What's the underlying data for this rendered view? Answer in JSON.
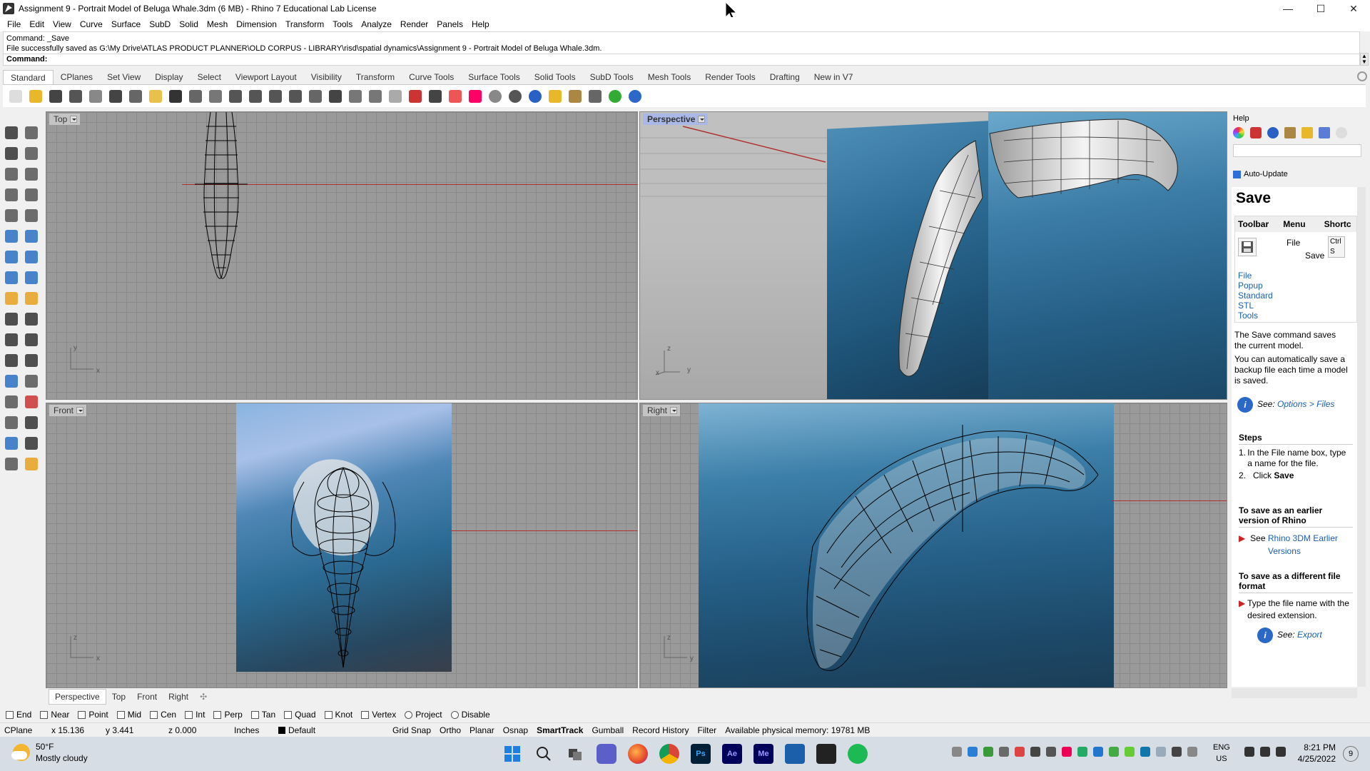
{
  "window": {
    "title": "Assignment 9 - Portrait Model of Beluga Whale.3dm (6 MB) - Rhino 7 Educational Lab License",
    "controls": {
      "minimize": "—",
      "maximize": "☐",
      "close": "✕"
    }
  },
  "menu": [
    "File",
    "Edit",
    "View",
    "Curve",
    "Surface",
    "SubD",
    "Solid",
    "Mesh",
    "Dimension",
    "Transform",
    "Tools",
    "Analyze",
    "Render",
    "Panels",
    "Help"
  ],
  "command": {
    "history_1": "Command: _Save",
    "history_2": "File successfully saved as G:\\My Drive\\ATLAS PRODUCT PLANNER\\OLD CORPUS - LIBRARY\\risd\\spatial dynamics\\Assignment 9 - Portrait Model of Beluga Whale.3dm.",
    "prompt": "Command:",
    "value": ""
  },
  "toolbar_tabs": [
    "Standard",
    "CPlanes",
    "Set View",
    "Display",
    "Select",
    "Viewport Layout",
    "Visibility",
    "Transform",
    "Curve Tools",
    "Surface Tools",
    "Solid Tools",
    "SubD Tools",
    "Mesh Tools",
    "Render Tools",
    "Drafting",
    "New in V7"
  ],
  "toolbar_icons": [
    "new-icon",
    "open-icon",
    "save-icon",
    "print-icon",
    "import-icon",
    "cut-icon",
    "copy-icon",
    "paste-icon",
    "undo-icon",
    "pan-hand-icon",
    "move-view-icon",
    "zoom-icon",
    "zoom-window-icon",
    "zoom-extents-icon",
    "zoom-selected-icon",
    "rotate-view-icon",
    "four-views-icon",
    "cplane-icon",
    "set-view-icon",
    "ghost-icon",
    "hide-icon",
    "lock-icon",
    "layer-icon",
    "color-icon",
    "shaded-icon",
    "rendered-icon",
    "material-icon",
    "select-filter-icon",
    "settings-icon",
    "lights-icon",
    "render-icon",
    "help-icon"
  ],
  "viewports": {
    "top": {
      "label": "Top",
      "axis_y": "y",
      "axis_x": "x"
    },
    "perspective": {
      "label": "Perspective",
      "axis_z": "z",
      "axis_x": "x",
      "axis_y": "y"
    },
    "front": {
      "label": "Front",
      "axis_z": "z",
      "axis_x": "x"
    },
    "right": {
      "label": "Right",
      "axis_z": "z",
      "axis_y": "y"
    }
  },
  "viewport_tabs": [
    "Perspective",
    "Top",
    "Front",
    "Right"
  ],
  "osnaps": [
    {
      "label": "End",
      "checked": false
    },
    {
      "label": "Near",
      "checked": false
    },
    {
      "label": "Point",
      "checked": false
    },
    {
      "label": "Mid",
      "checked": false
    },
    {
      "label": "Cen",
      "checked": false
    },
    {
      "label": "Int",
      "checked": false
    },
    {
      "label": "Perp",
      "checked": false
    },
    {
      "label": "Tan",
      "checked": false
    },
    {
      "label": "Quad",
      "checked": false
    },
    {
      "label": "Knot",
      "checked": false
    },
    {
      "label": "Vertex",
      "checked": false
    },
    {
      "label": "Project",
      "checked": false
    },
    {
      "label": "Disable",
      "checked": false
    }
  ],
  "status": {
    "cplane": "CPlane",
    "x": "x 15.136",
    "y": "y 3.441",
    "z": "z 0.000",
    "units": "Inches",
    "layer": "Default",
    "grid_snap": "Grid Snap",
    "ortho": "Ortho",
    "planar": "Planar",
    "osnap": "Osnap",
    "smarttrack": "SmartTrack",
    "gumball": "Gumball",
    "record_history": "Record History",
    "filter": "Filter",
    "memory": "Available physical memory: 19781 MB"
  },
  "help": {
    "panel_title": "Help",
    "auto_update": "Auto-Update",
    "heading": "Save",
    "table_headers": [
      "Toolbar",
      "Menu",
      "Shortc"
    ],
    "toolbar_links": [
      "File",
      "Popup",
      "Standard",
      "STL",
      "Tools"
    ],
    "menu_path": [
      "File",
      "Save"
    ],
    "shortcut": [
      "Ctrl",
      "S"
    ],
    "desc_1": "The Save command saves the current model.",
    "desc_2": "You can automatically save a backup file each time a model is saved.",
    "see_label": "See:",
    "see_link": "Options > Files",
    "steps_title": "Steps",
    "step_1a": "In the File name box, type a name for the file.",
    "step_2_prefix": "Click",
    "step_2_bold": "Save",
    "earlier_title": "To save as an earlier version of Rhino",
    "earlier_prefix": "See",
    "earlier_link": "Rhino 3DM Earlier Versions",
    "different_title": "To save as a different file format",
    "different_text": "Type the file name with the desired extension.",
    "export_link": "Export"
  },
  "taskbar": {
    "temperature": "50°F",
    "condition": "Mostly cloudy",
    "apps": [
      "windows-start-icon",
      "search-icon",
      "task-view-icon",
      "chat-icon",
      "firefox-icon",
      "chrome-icon",
      "photoshop-icon",
      "after-effects-icon",
      "media-encoder-icon",
      "photos-icon",
      "rhino-icon",
      "spotify-icon"
    ],
    "app_labels": {
      "ps": "Ps",
      "ae": "Ae",
      "me": "Me"
    },
    "lang_1": "ENG",
    "lang_2": "US",
    "time": "8:21 PM",
    "date": "4/25/2022",
    "notification_count": "9"
  },
  "colors": {
    "viewport_bg": "#9a9a9a",
    "active_label": "#aab8e8",
    "axis_red": "#b03030",
    "water": "#2b6a93"
  }
}
